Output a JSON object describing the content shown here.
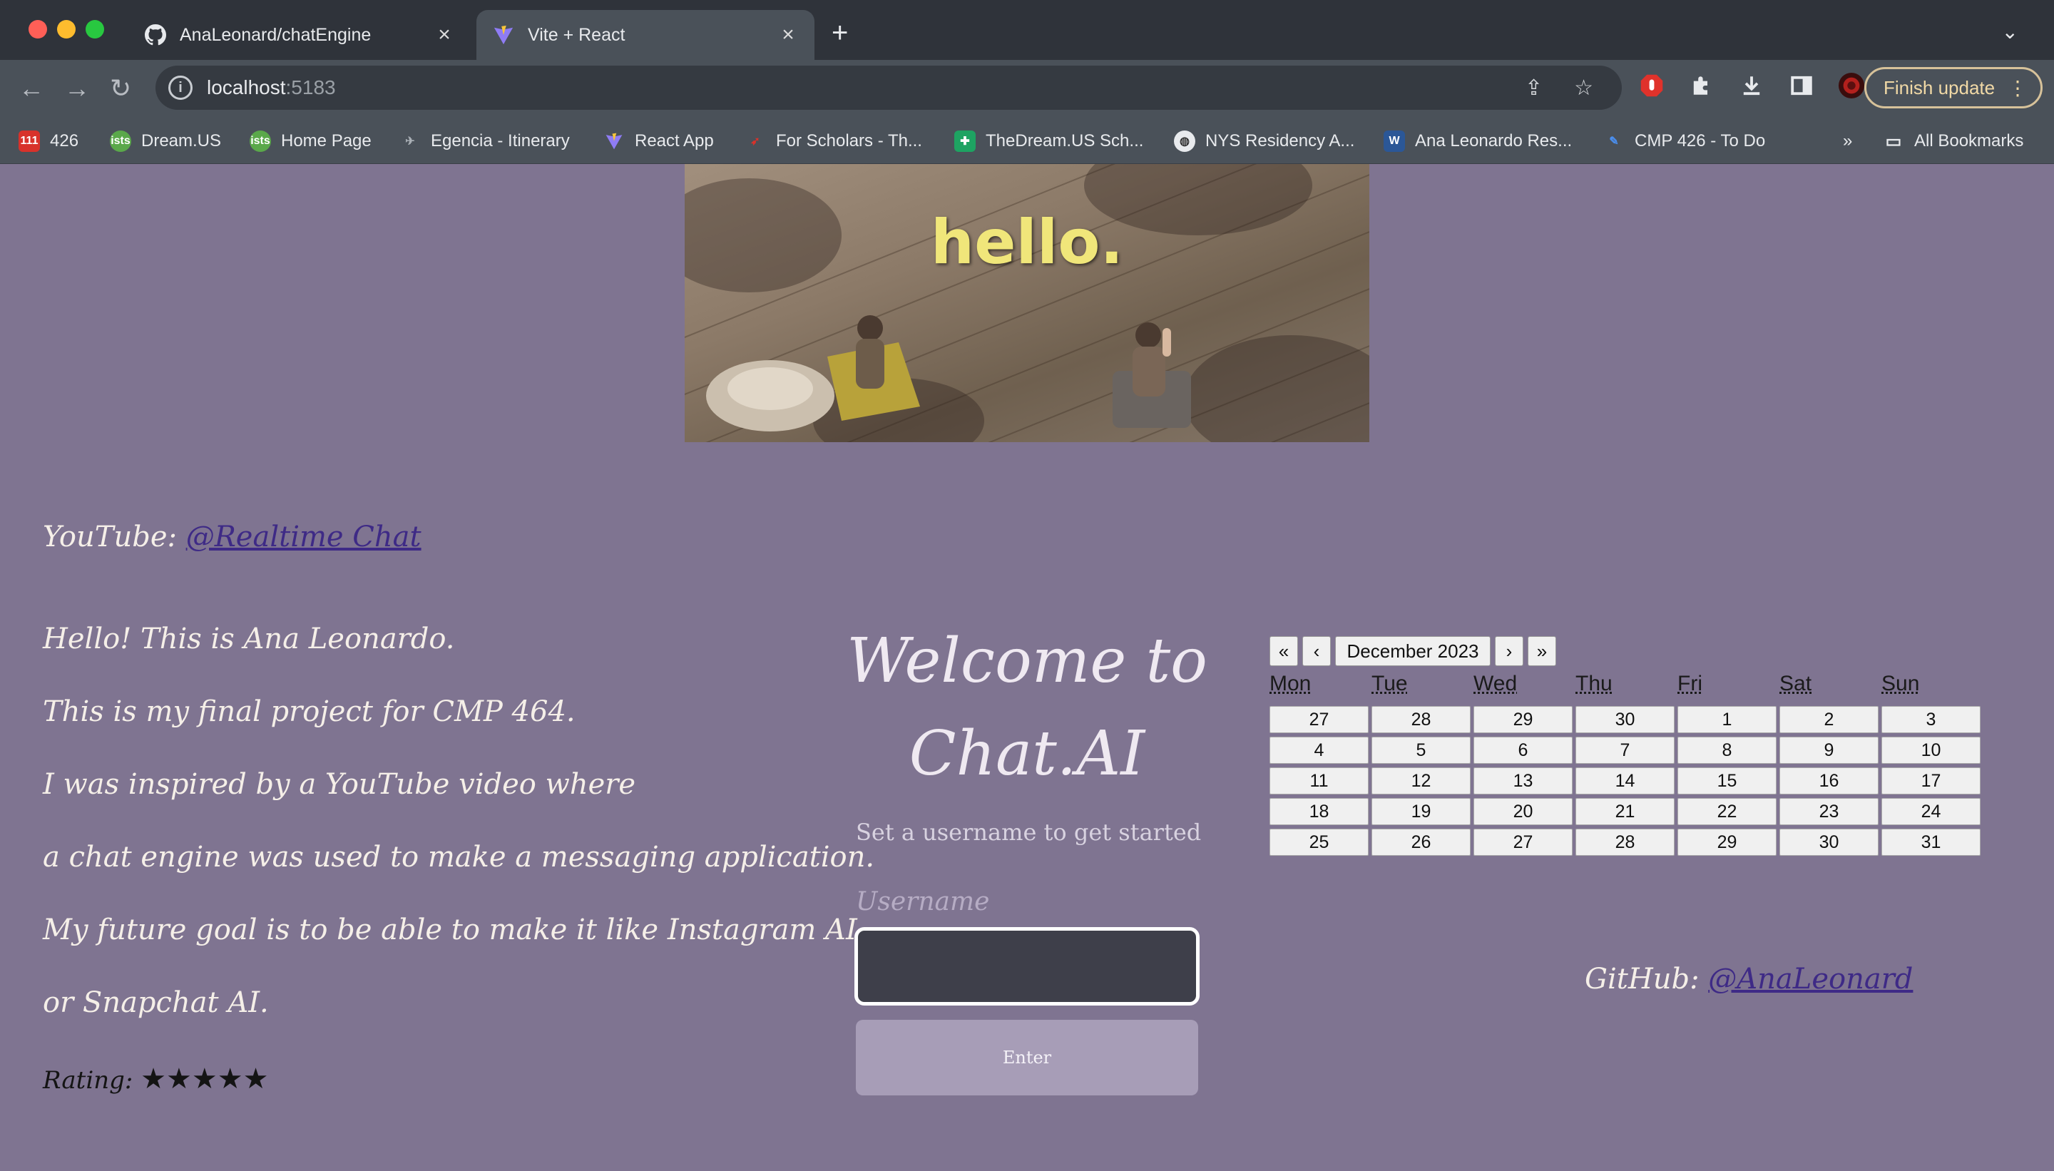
{
  "browser": {
    "tabs": [
      {
        "title": "AnaLeonard/chatEngine",
        "active": false,
        "icon": "github-icon"
      },
      {
        "title": "Vite + React",
        "active": true,
        "icon": "vite-icon"
      }
    ],
    "url_host": "localhost",
    "url_port": ":5183",
    "finish_update": "Finish update",
    "bookmarks": [
      {
        "label": "426",
        "icon": "calendar-icon"
      },
      {
        "label": "Dream.US",
        "icon": "ists-icon"
      },
      {
        "label": "Home Page",
        "icon": "ists-icon"
      },
      {
        "label": "Egencia - Itinerary",
        "icon": "plane-icon"
      },
      {
        "label": "React App",
        "icon": "vite-icon"
      },
      {
        "label": "For Scholars - Th...",
        "icon": "dream-icon"
      },
      {
        "label": "TheDream.US Sch...",
        "icon": "sheets-icon"
      },
      {
        "label": "NYS Residency A...",
        "icon": "globe-icon"
      },
      {
        "label": "Ana Leonardo Res...",
        "icon": "word-icon"
      },
      {
        "label": "CMP 426 - To Do",
        "icon": "pencil-icon"
      }
    ],
    "more_bookmarks": "»",
    "all_bookmarks": "All Bookmarks"
  },
  "hero": {
    "text": "hello."
  },
  "youtube": {
    "label": "YouTube: ",
    "link": "@Realtime Chat"
  },
  "intro": [
    "Hello! This is Ana Leonardo.",
    "This is my final project for CMP 464.",
    "I was inspired by a YouTube video where",
    "a chat engine was used to make a messaging application.",
    "My future goal is to be able to make it like Instagram AI",
    "or Snapchat AI."
  ],
  "rating": {
    "label": "Rating: ",
    "stars": "★★★★★"
  },
  "welcome": {
    "line1": "Welcome to",
    "line2": "Chat.AI"
  },
  "form": {
    "subtitle": "Set a username to get started",
    "username_label": "Username",
    "username_value": "",
    "enter_label": "Enter"
  },
  "calendar": {
    "prev_year": "«",
    "prev_month": "‹",
    "month_label": "December 2023",
    "next_month": "›",
    "next_year": "»",
    "weekdays": [
      "Mon",
      "Tue",
      "Wed",
      "Thu",
      "Fri",
      "Sat",
      "Sun"
    ],
    "days": [
      "27",
      "28",
      "29",
      "30",
      "1",
      "2",
      "3",
      "4",
      "5",
      "6",
      "7",
      "8",
      "9",
      "10",
      "11",
      "12",
      "13",
      "14",
      "15",
      "16",
      "17",
      "18",
      "19",
      "20",
      "21",
      "22",
      "23",
      "24",
      "25",
      "26",
      "27",
      "28",
      "29",
      "30",
      "31"
    ]
  },
  "github": {
    "label": "GitHub: ",
    "link": "@AnaLeonard"
  },
  "colors": {
    "page_bg": "#7f7491",
    "link": "#3e2a86",
    "button_bg": "#a79db7"
  }
}
